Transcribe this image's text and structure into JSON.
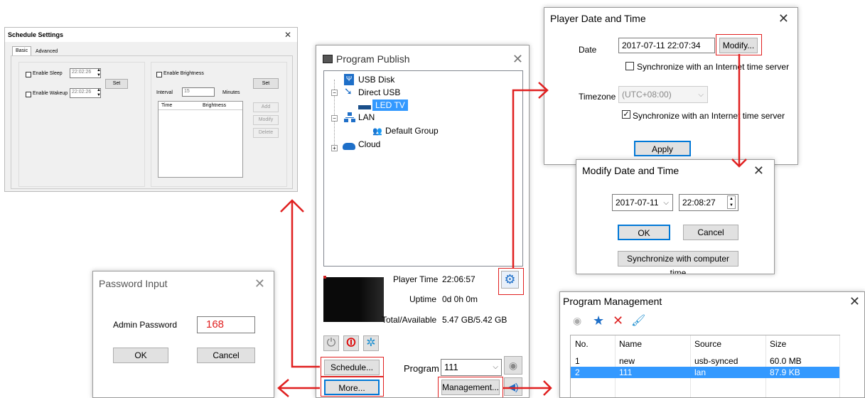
{
  "schedule": {
    "title": "Schedule Settings",
    "tab_basic": "Basic",
    "tab_advanced": "Advanced",
    "enable_sleep": "Enable Sleep",
    "sleep_time": "22:02:26",
    "enable_wakeup": "Enable Wakeup",
    "wakeup_time": "22:02:26",
    "set_left": "Set",
    "enable_brightness": "Enable Brightness",
    "set_right": "Set",
    "interval_label": "Interval",
    "interval_value": "15",
    "minutes_label": "Minutes",
    "col_time": "Time",
    "col_brightness": "Brightness",
    "add": "Add",
    "modify": "Modify",
    "delete": "Delete"
  },
  "publish": {
    "title": "Program Publish",
    "tree": {
      "usb_disk": "USB Disk",
      "direct_usb": "Direct USB",
      "led_tv": "LED TV",
      "lan": "LAN",
      "default_group": "Default Group",
      "cloud": "Cloud"
    },
    "player_time_label": "Player Time",
    "player_time_value": "22:06:57",
    "uptime_label": "Uptime",
    "uptime_value": "0d 0h 0m",
    "storage_label": "Total/Available",
    "storage_value": "5.47 GB/5.42 GB",
    "schedule_btn": "Schedule...",
    "more_btn": "More...",
    "program_label": "Program",
    "program_value": "111",
    "management_btn": "Management..."
  },
  "datetime": {
    "title": "Player Date and Time",
    "date_label": "Date",
    "date_value": "2017-07-11 22:07:34",
    "modify_btn": "Modify...",
    "sync1": "Synchronize with an Internet time server",
    "timezone_label": "Timezone",
    "timezone_value": "(UTC+08:00)",
    "sync2": "Synchronize with an Internet time server",
    "apply_btn": "Apply"
  },
  "modify": {
    "title": "Modify Date and Time",
    "date_value": "2017-07-11",
    "time_value": "22:08:27",
    "ok": "OK",
    "cancel": "Cancel",
    "sync_btn": "Synchronize with computer time"
  },
  "password": {
    "title": "Password Input",
    "label": "Admin Password",
    "value": "168",
    "ok": "OK",
    "cancel": "Cancel"
  },
  "management": {
    "title": "Program Management",
    "columns": [
      "No.",
      "Name",
      "Source",
      "Size"
    ],
    "rows": [
      [
        "1",
        "new",
        "usb-synced",
        "60.0 MB"
      ],
      [
        "2",
        "111",
        "lan",
        "87.9 KB"
      ]
    ]
  },
  "colors": {
    "accent": "#e02020",
    "select": "#3399ff"
  }
}
